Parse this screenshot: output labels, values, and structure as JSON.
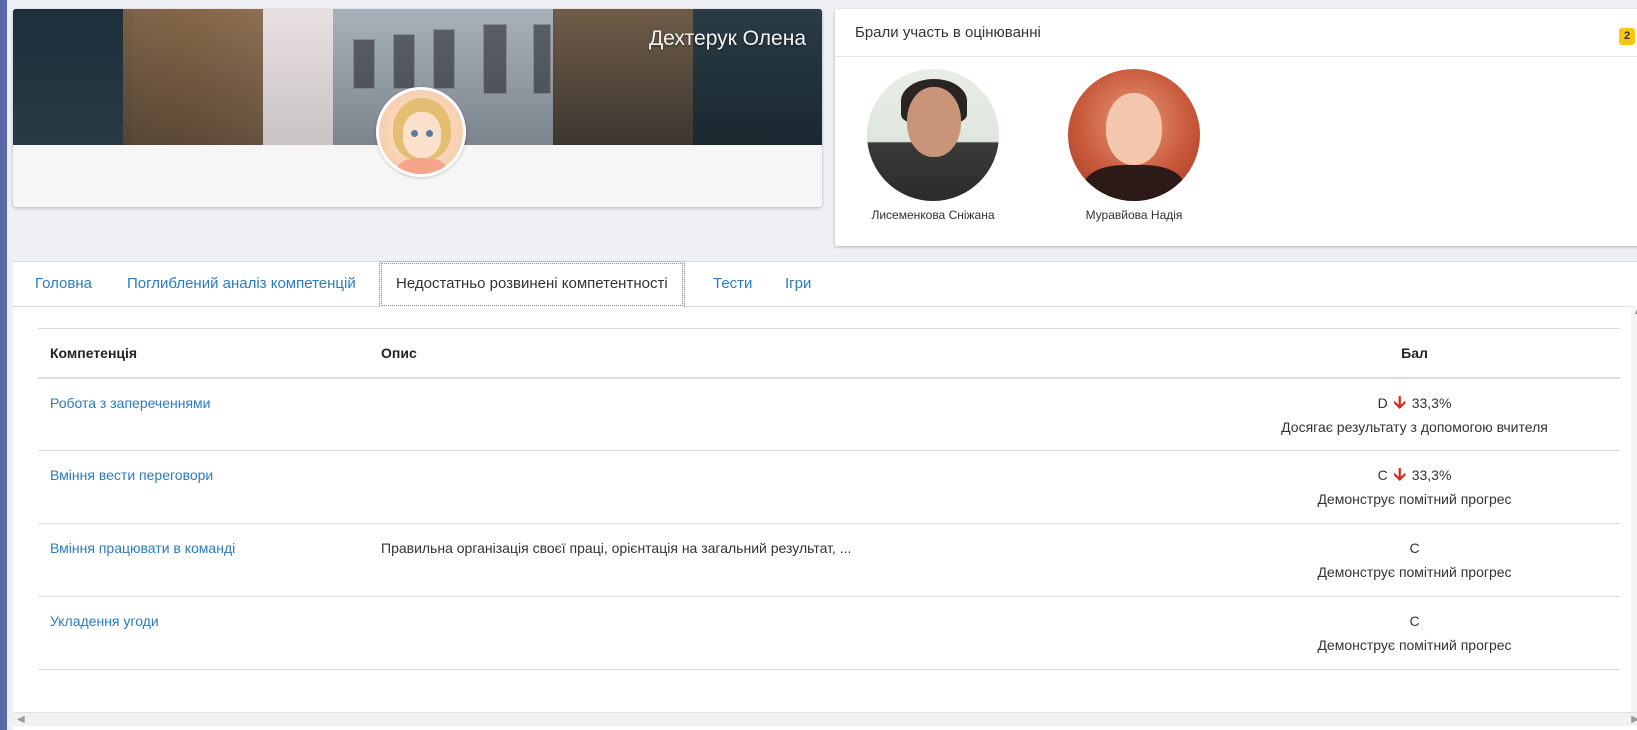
{
  "profile": {
    "name": "Дехтерук Олена",
    "avatar_icon": "user-avatar-illustration"
  },
  "participants": {
    "title": "Брали участь в оцінюванні",
    "count": "2",
    "items": [
      {
        "name": "Лисеменкова Сніжана"
      },
      {
        "name": "Муравйова Надія"
      }
    ]
  },
  "tabs": [
    {
      "label": "Головна",
      "active": false
    },
    {
      "label": "Поглиблений аналіз компетенцій",
      "active": false
    },
    {
      "label": "Недостатньо розвинені компетентності",
      "active": true
    },
    {
      "label": "Тести",
      "active": false
    },
    {
      "label": "Ігри",
      "active": false
    }
  ],
  "table": {
    "headers": {
      "competency": "Компетенція",
      "description": "Опис",
      "score": "Бал"
    },
    "rows": [
      {
        "competency": "Робота з запереченнями",
        "description": "",
        "grade": "D",
        "trend_icon": "arrow-down-icon",
        "percent": "33,3%",
        "level": "Досягає результату з допомогою вчителя"
      },
      {
        "competency": "Вміння вести переговори",
        "description": "",
        "grade": "C",
        "trend_icon": "arrow-down-icon",
        "percent": "33,3%",
        "level": "Демонструє помітний прогрес"
      },
      {
        "competency": "Вміння працювати в команді",
        "description": "Правильна організація своєї праці, орієнтація на загальний результат, ...",
        "grade": "C",
        "percent": "",
        "level": "Демонструє помітний прогрес"
      },
      {
        "competency": "Укладення угоди",
        "description": "",
        "grade": "C",
        "percent": "",
        "level": "Демонструє помітний прогрес"
      }
    ]
  },
  "colors": {
    "link": "#2a7bbf",
    "trend_down": "#e0201b",
    "badge": "#f5c518"
  }
}
